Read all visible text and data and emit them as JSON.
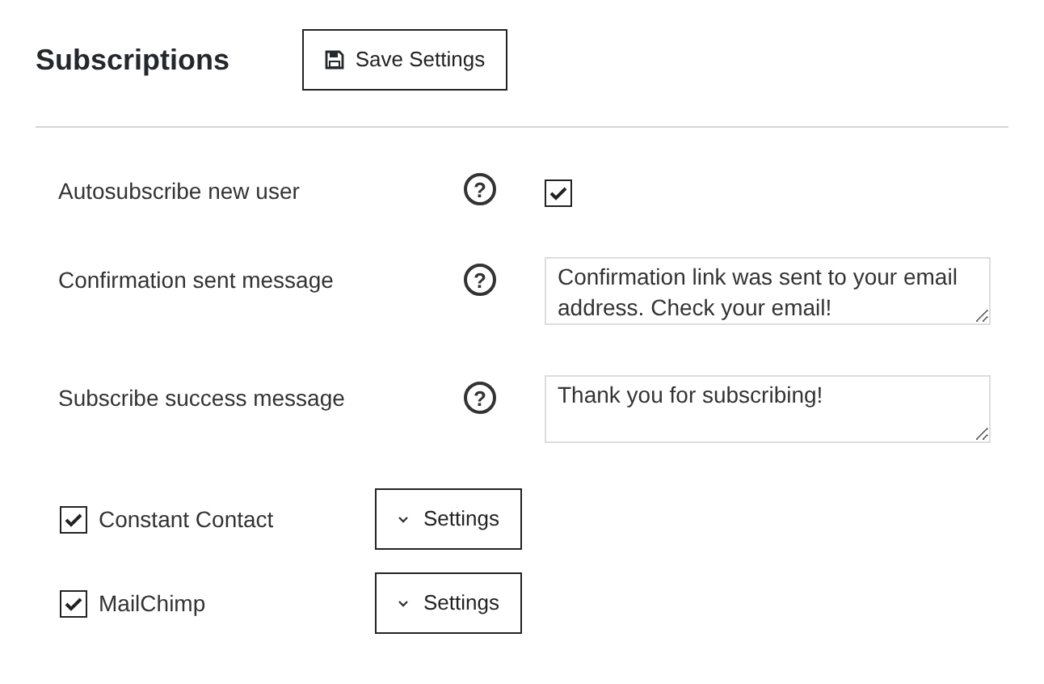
{
  "header": {
    "title": "Subscriptions",
    "save_button": "Save Settings"
  },
  "settings": [
    {
      "kind": "checkbox",
      "label": "Autosubscribe new user",
      "help": "?",
      "checked": true
    },
    {
      "kind": "textarea",
      "label": "Confirmation sent message",
      "help": "?",
      "value": "Confirmation link was sent to your email address. Check your email!"
    },
    {
      "kind": "textarea",
      "label": "Subscribe success message",
      "help": "?",
      "value": "Thank you for subscribing!"
    }
  ],
  "services": [
    {
      "label": "Constant Contact",
      "checked": true,
      "button": "Settings"
    },
    {
      "label": "MailChimp",
      "checked": true,
      "button": "Settings"
    }
  ]
}
